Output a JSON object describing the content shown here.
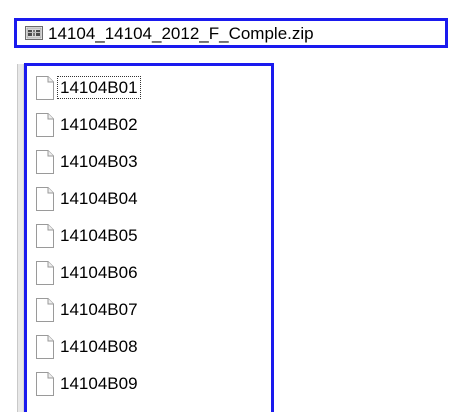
{
  "archive": {
    "icon": "zip-archive-icon",
    "name": "14104_14104_2012_F_Comple.zip"
  },
  "files": [
    {
      "name": "14104B01",
      "icon": "document-icon",
      "selected": true
    },
    {
      "name": "14104B02",
      "icon": "document-icon",
      "selected": false
    },
    {
      "name": "14104B03",
      "icon": "document-icon",
      "selected": false
    },
    {
      "name": "14104B04",
      "icon": "document-icon",
      "selected": false
    },
    {
      "name": "14104B05",
      "icon": "document-icon",
      "selected": false
    },
    {
      "name": "14104B06",
      "icon": "document-icon",
      "selected": false
    },
    {
      "name": "14104B07",
      "icon": "document-icon",
      "selected": false
    },
    {
      "name": "14104B08",
      "icon": "document-icon",
      "selected": false
    },
    {
      "name": "14104B09",
      "icon": "document-icon",
      "selected": false
    }
  ],
  "colors": {
    "highlight_border": "#1a1aee"
  }
}
